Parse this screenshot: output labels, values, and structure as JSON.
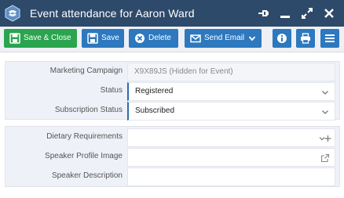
{
  "window": {
    "title": "Event attendance for Aaron Ward",
    "controls": [
      "pin-icon",
      "minimize-icon",
      "maximize-icon",
      "close-icon"
    ]
  },
  "toolbar": {
    "save_close_label": "Save & Close",
    "save_label": "Save",
    "delete_label": "Delete",
    "send_email_label": "Send Email",
    "icons": [
      "info-icon",
      "print-icon",
      "menu-icon"
    ],
    "colors": {
      "green": "#2aa44f",
      "blue": "#2d78be",
      "titlebar": "#2e4a6b"
    }
  },
  "form": {
    "section1": [
      {
        "label": "Marketing Campaign",
        "value": "X9X89JS (Hidden for Event)"
      },
      {
        "label": "Status",
        "value": "Registered"
      },
      {
        "label": "Subscription Status",
        "value": "Subscribed"
      }
    ],
    "section2": [
      {
        "label": "Dietary Requirements",
        "value": ""
      },
      {
        "label": "Speaker Profile Image",
        "value": ""
      },
      {
        "label": "Speaker Description",
        "value": ""
      }
    ]
  }
}
